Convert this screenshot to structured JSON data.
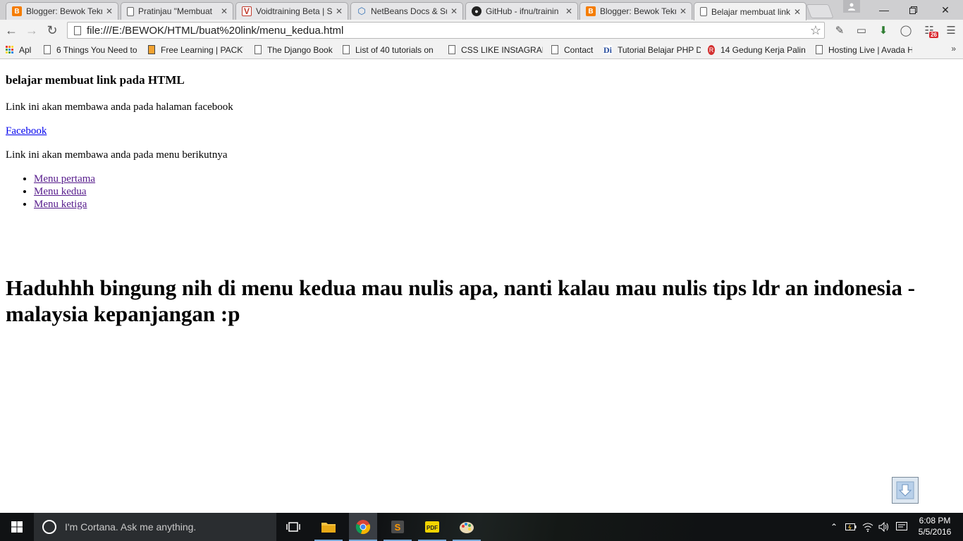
{
  "browser": {
    "tabs": [
      {
        "title": "Blogger: Bewok Tekn",
        "icon": "blogger-icon"
      },
      {
        "title": "Pratinjau \"Membuat",
        "icon": "page-icon"
      },
      {
        "title": "Voidtraining Beta | S",
        "icon": "voidtraining-icon"
      },
      {
        "title": "NetBeans Docs & Su",
        "icon": "netbeans-icon"
      },
      {
        "title": "GitHub - ifnu/trainin",
        "icon": "github-icon"
      },
      {
        "title": "Blogger: Bewok Tekn",
        "icon": "blogger-icon"
      },
      {
        "title": "Belajar membuat link",
        "icon": "page-icon",
        "active": true
      }
    ],
    "url": "file:///E:/BEWOK/HTML/buat%20link/menu_kedua.html",
    "extension_badge": "26",
    "bookmarks": [
      {
        "label": "Apl",
        "icon": "apps-icon"
      },
      {
        "label": "6 Things You Need to",
        "icon": "page-icon"
      },
      {
        "label": "Free Learning | PACKT",
        "icon": "packt-icon"
      },
      {
        "label": "The Django Book",
        "icon": "page-icon"
      },
      {
        "label": "List of 40 tutorials on",
        "icon": "page-icon"
      },
      {
        "label": "CSS LIKE INStAGRAM",
        "icon": "page-icon"
      },
      {
        "label": "Contact",
        "icon": "page-icon"
      },
      {
        "label": "Tutorial Belajar PHP D",
        "icon": "di-icon"
      },
      {
        "label": "14 Gedung Kerja Palin",
        "icon": "red-circle-icon"
      },
      {
        "label": "Hosting Live | Avada H",
        "icon": "page-icon"
      }
    ],
    "bookmarks_more": "»"
  },
  "page": {
    "heading": "belajar membuat link pada HTML",
    "text_facebook": "Link ini akan membawa anda pada halaman facebook",
    "link_facebook": "Facebook",
    "text_menu": "Link ini akan membawa anda pada menu berikutnya",
    "menu": [
      "Menu pertama",
      "Menu kedua",
      "Menu ketiga"
    ],
    "big_text": "Haduhhh bingung nih di menu kedua mau nulis apa, nanti kalau mau nulis tips ldr an indonesia - malaysia kepanjangan :p"
  },
  "taskbar": {
    "cortana_placeholder": "I'm Cortana. Ask me anything.",
    "time": "6:08 PM",
    "date": "5/5/2016"
  },
  "colors": {
    "link": "#0000ee",
    "visited": "#551a8b",
    "taskbar": "#101214",
    "blogger": "#f57d00"
  }
}
